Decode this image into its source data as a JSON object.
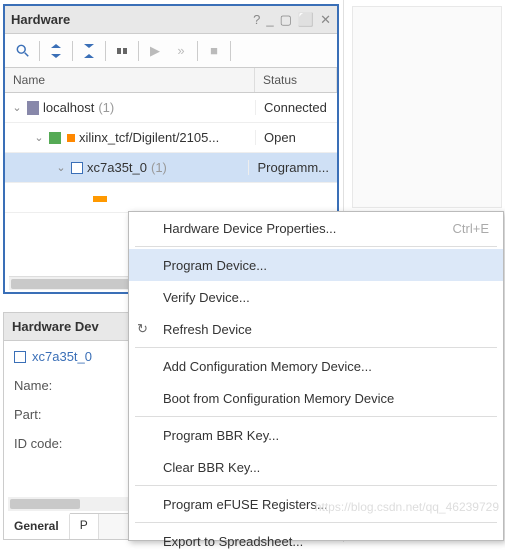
{
  "panel": {
    "title": "Hardware",
    "name_col": "Name",
    "status_col": "Status"
  },
  "tree": [
    {
      "indent": 0,
      "label": "localhost",
      "suffix": "(1)",
      "status": "Connected",
      "icon": "server",
      "expanded": true
    },
    {
      "indent": 1,
      "label": "xilinx_tcf/Digilent/2105...",
      "suffix": "",
      "status": "Open",
      "icon": "tcf",
      "expanded": true
    },
    {
      "indent": 2,
      "label": "xc7a35t_0",
      "suffix": "(1)",
      "status": "Programm...",
      "icon": "chip",
      "expanded": true,
      "selected": true
    },
    {
      "indent": 3,
      "label": "",
      "suffix": "",
      "status": "",
      "icon": "core",
      "expanded": false
    }
  ],
  "props": {
    "header": "Hardware Dev",
    "device": "xc7a35t_0",
    "rows": {
      "name": "Name:",
      "part": "Part:",
      "id": "ID code:"
    },
    "tab_general": "General",
    "tab_other": "P"
  },
  "context_menu": {
    "items": [
      {
        "label": "Hardware Device Properties...",
        "shortcut": "Ctrl+E"
      },
      {
        "sep": true
      },
      {
        "label": "Program Device...",
        "highlight": true
      },
      {
        "label": "Verify Device..."
      },
      {
        "label": "Refresh Device",
        "icon": "refresh"
      },
      {
        "sep": true
      },
      {
        "label": "Add Configuration Memory Device..."
      },
      {
        "label": "Boot from Configuration Memory Device"
      },
      {
        "sep": true
      },
      {
        "label": "Program BBR Key..."
      },
      {
        "label": "Clear BBR Key..."
      },
      {
        "sep": true
      },
      {
        "label": "Program eFUSE Registers..."
      },
      {
        "sep": true
      },
      {
        "label": "Export to Spreadsheet..."
      }
    ]
  },
  "watermark": "https://blog.csdn.net/qq_46239729"
}
